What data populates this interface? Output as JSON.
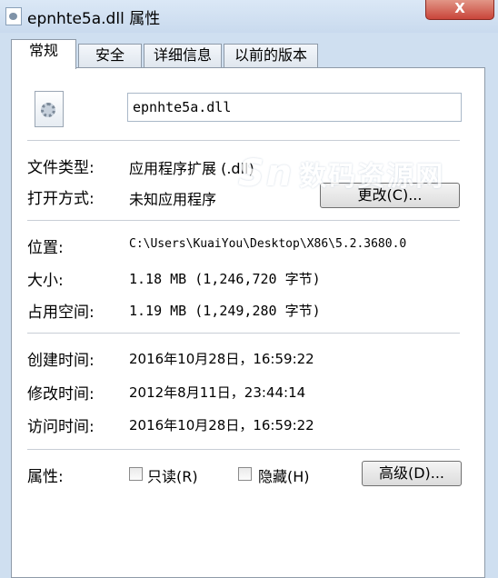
{
  "window": {
    "title": "epnhte5a.dll 属性",
    "close_label": "X"
  },
  "tabs": [
    "常规",
    "安全",
    "详细信息",
    "以前的版本"
  ],
  "general": {
    "file_name": "epnhte5a.dll",
    "file_type": {
      "label": "文件类型:",
      "value": "应用程序扩展 (.dll)"
    },
    "opens_with": {
      "label": "打开方式:",
      "value": "未知应用程序",
      "button": "更改(C)..."
    },
    "location": {
      "label": "位置:",
      "value": "C:\\Users\\KuaiYou\\Desktop\\X86\\5.2.3680.0"
    },
    "size": {
      "label": "大小:",
      "value": "1.18 MB (1,246,720 字节)"
    },
    "size_on_disk": {
      "label": "占用空间:",
      "value": "1.19 MB (1,249,280 字节)"
    },
    "created": {
      "label": "创建时间:",
      "value": "2016年10月28日，16:59:22"
    },
    "modified": {
      "label": "修改时间:",
      "value": "2012年8月11日，23:44:14"
    },
    "accessed": {
      "label": "访问时间:",
      "value": "2016年10月28日，16:59:22"
    },
    "attributes": {
      "label": "属性:",
      "readonly": "只读(R)",
      "readonly_checked": false,
      "hidden": "隐藏(H)",
      "hidden_checked": false,
      "advanced_button": "高级(D)..."
    }
  },
  "watermark": {
    "logo": "Sn",
    "text": "数码资源网"
  }
}
